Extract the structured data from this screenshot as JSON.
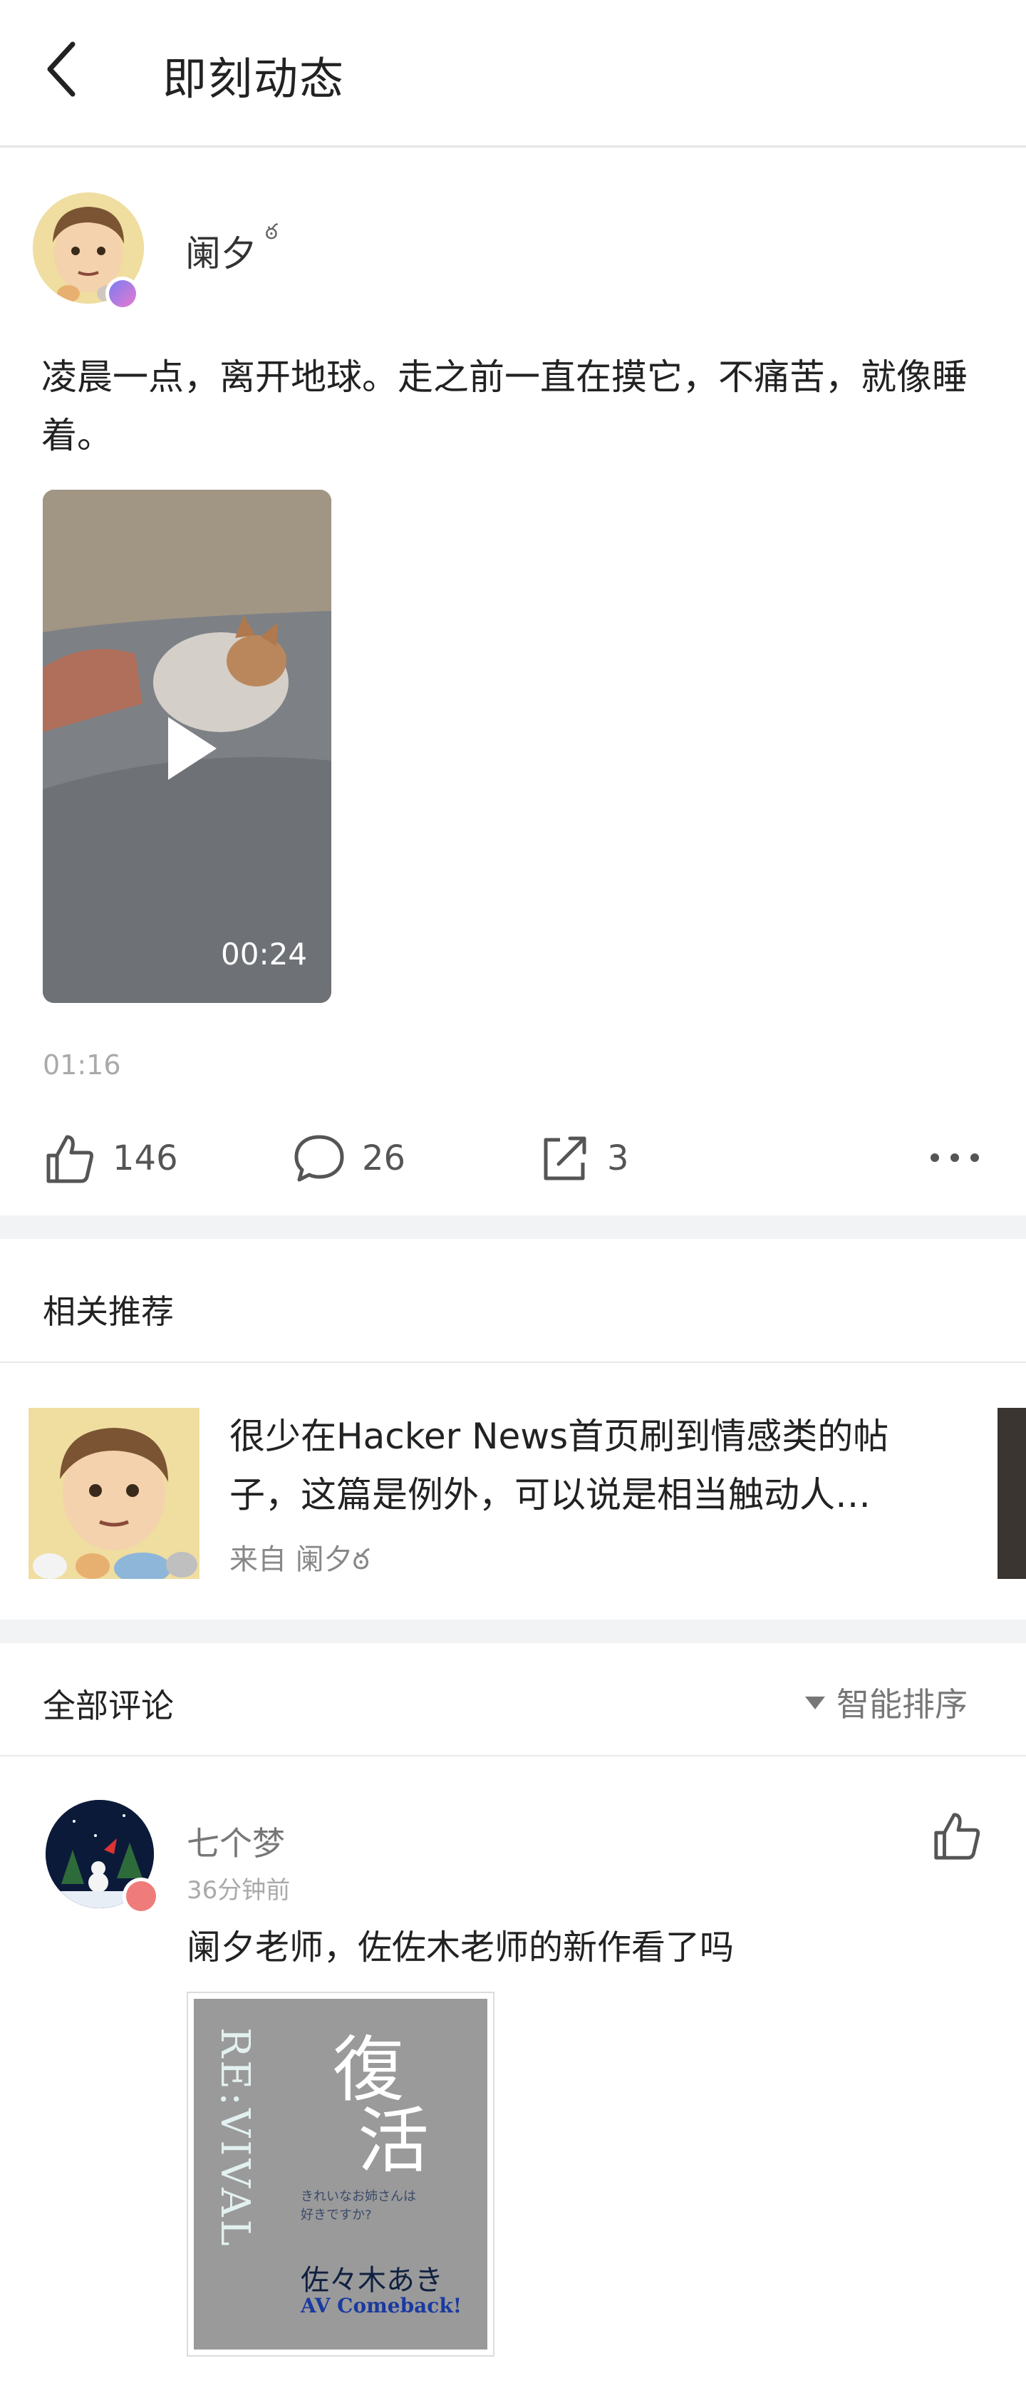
{
  "header": {
    "title": "即刻动态"
  },
  "post": {
    "author": "阑夕",
    "author_mark": "ఠ",
    "text": "凌晨一点，离开地球。走之前一直在摸它，不痛苦，就像睡着。",
    "video_duration": "00:24",
    "time": "01:16",
    "likes": "146",
    "comments": "26",
    "shares": "3"
  },
  "related": {
    "title": "相关推荐",
    "item": {
      "text": "很少在Hacker News首页刷到情感类的帖子，这篇是例外，可以说是相当触动人…",
      "source": "来自 阑夕ఠ"
    }
  },
  "comments_section": {
    "title": "全部评论",
    "sort_label": "智能排序"
  },
  "comment": {
    "author": "七个梦",
    "time": "36分钟前",
    "text": "阑夕老师，佐佐木老师的新作看了吗",
    "image_text": {
      "line1": "復",
      "line2": "活",
      "vertical": "RE:VIVAL",
      "jp": "きれいなお姉さんは好きですか?",
      "name": "佐々木あき",
      "tag": "AV Comeback!"
    }
  },
  "colors": {
    "divider": "#e9e9e9",
    "section_gap": "#f2f3f5",
    "muted_text": "#aaaaaa"
  },
  "icons": {
    "back": "chevron-left-icon",
    "like": "thumbs-up-icon",
    "comment": "speech-bubble-icon",
    "share": "share-icon",
    "more": "more-dots-icon",
    "sort": "triangle-down-icon",
    "play": "play-icon"
  }
}
